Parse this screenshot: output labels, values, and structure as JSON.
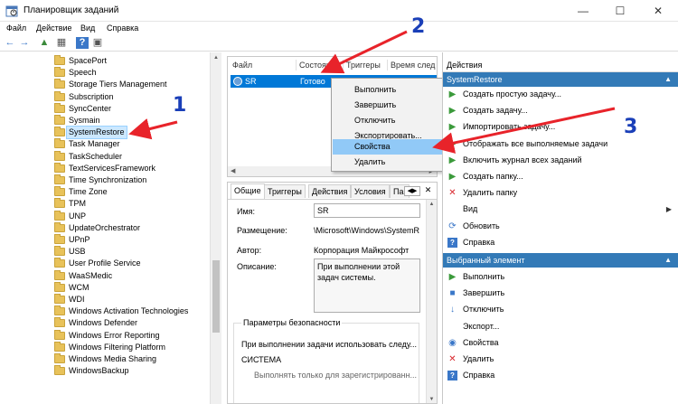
{
  "window": {
    "title": "Планировщик заданий",
    "minimize": "—",
    "maximize": "☐",
    "close": "✕"
  },
  "menu": [
    "Файл",
    "Действие",
    "Вид",
    "Справка"
  ],
  "toolbar": {
    "back": "←",
    "forward": "→",
    "up": "▲",
    "props": "▦",
    "help": "?",
    "view": "▣"
  },
  "tree": {
    "items": [
      {
        "label": "SpacePort"
      },
      {
        "label": "Speech"
      },
      {
        "label": "Storage Tiers Management"
      },
      {
        "label": "Subscription"
      },
      {
        "label": "SyncCenter"
      },
      {
        "label": "Sysmain"
      },
      {
        "label": "SystemRestore",
        "selected": true
      },
      {
        "label": "Task Manager"
      },
      {
        "label": "TaskScheduler"
      },
      {
        "label": "TextServicesFramework"
      },
      {
        "label": "Time Synchronization"
      },
      {
        "label": "Time Zone"
      },
      {
        "label": "TPM"
      },
      {
        "label": "UNP"
      },
      {
        "label": "UpdateOrchestrator"
      },
      {
        "label": "UPnP"
      },
      {
        "label": "USB"
      },
      {
        "label": "User Profile Service"
      },
      {
        "label": "WaaSMedic"
      },
      {
        "label": "WCM"
      },
      {
        "label": "WDI"
      },
      {
        "label": "Windows Activation Technologies"
      },
      {
        "label": "Windows Defender"
      },
      {
        "label": "Windows Error Reporting"
      },
      {
        "label": "Windows Filtering Platform"
      },
      {
        "label": "Windows Media Sharing"
      },
      {
        "label": "WindowsBackup"
      }
    ]
  },
  "task_list": {
    "columns": [
      "Файл",
      "Состояние",
      "Триггеры",
      "Время след"
    ],
    "row": {
      "name": "SR",
      "state": "Готово"
    }
  },
  "context_menu": {
    "items": [
      {
        "label": "Выполнить"
      },
      {
        "label": "Завершить"
      },
      {
        "label": "Отключить"
      },
      {
        "label": "Экспортировать..."
      },
      {
        "label": "Свойства",
        "highlighted": true
      },
      {
        "label": "Удалить"
      }
    ]
  },
  "details": {
    "tabs": [
      "Общие",
      "Триггеры",
      "Действия",
      "Условия",
      "Парa"
    ],
    "name_label": "Имя:",
    "name_value": "SR",
    "location_label": "Размещение:",
    "location_value": "\\Microsoft\\Windows\\SystemR",
    "author_label": "Автор:",
    "author_value": "Корпорация Майкрософт",
    "desc_label": "Описание:",
    "desc_value": "При выполнении этой задач системы.",
    "security_title": "Параметры безопасности",
    "security_text": "При выполнении задачи использовать следу...",
    "security_account": "СИСТЕМА",
    "security_more": "Выполнять только для зарегистрированн..."
  },
  "actions": {
    "header": "Действия",
    "task_header": "SystemRestore",
    "items": [
      {
        "icon": "▶",
        "label": "Создать простую задачу..."
      },
      {
        "icon": "▶",
        "label": "Создать задачу..."
      },
      {
        "icon": "▶",
        "label": "Импортировать задачу..."
      },
      {
        "icon": "▶",
        "label": "Отображать все выполняемые задачи"
      },
      {
        "icon": "▶",
        "label": "Включить журнал всех заданий"
      },
      {
        "icon": "▶",
        "label": "Создать папку..."
      },
      {
        "icon": "✕",
        "label": "Удалить папку"
      },
      {
        "icon": "",
        "label": "Вид"
      },
      {
        "icon": "⟳",
        "label": "Обновить"
      },
      {
        "icon": "?",
        "label": "Справка"
      }
    ],
    "selected_header": "Выбранный элемент",
    "selected_items": [
      {
        "icon": "▶",
        "label": "Выполнить"
      },
      {
        "icon": "■",
        "label": "Завершить"
      },
      {
        "icon": "↓",
        "label": "Отключить"
      },
      {
        "icon": "",
        "label": "Экспорт..."
      },
      {
        "icon": "◉",
        "label": "Свойства"
      },
      {
        "icon": "✕",
        "label": "Удалить"
      },
      {
        "icon": "?",
        "label": "Справка"
      }
    ]
  },
  "annotations": {
    "one": "1",
    "two": "2",
    "three": "3"
  },
  "colors": {
    "accent": "#0078d7",
    "arrow": "#e8232a",
    "annotation": "#1a3fb8"
  }
}
